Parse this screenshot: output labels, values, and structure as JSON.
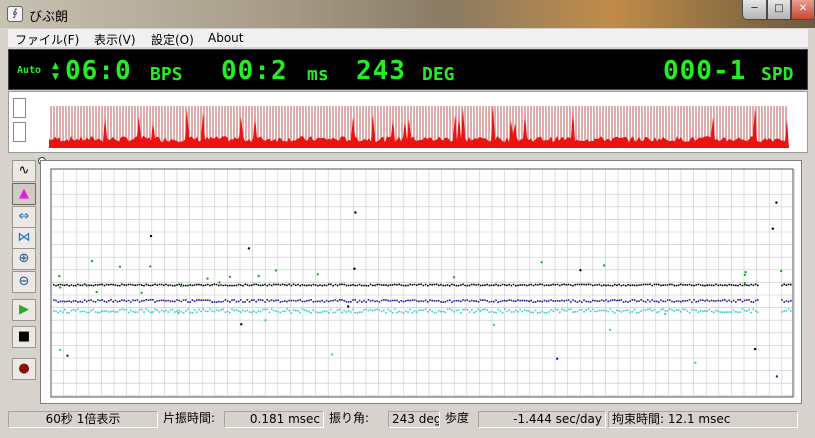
{
  "window": {
    "title": "びぶ朗",
    "app_icon_glyph": "∮",
    "minimize": "─",
    "maximize": "□",
    "close": "✕"
  },
  "menu": [
    {
      "label": "ファイル(F)"
    },
    {
      "label": "表示(V)"
    },
    {
      "label": "設定(O)"
    },
    {
      "label": "About"
    }
  ],
  "display": {
    "mode": "Auto",
    "bph_value": "06:0",
    "bph_unit": "BPS",
    "ms_value": "00:2",
    "ms_unit": "ms",
    "deg_value": "243",
    "deg_unit": "DEG",
    "spd_value": "000-1",
    "spd_unit": "SPD",
    "led_color": "#22ee22"
  },
  "colors": {
    "strip_wave": "#ee1111",
    "strip_bars": "#aa2222",
    "trace_black": "#000000",
    "trace_blue": "#1a1a9a",
    "trace_cyan": "#33cccc",
    "trace_green": "#22aa22",
    "grid": "#c8c8c8"
  },
  "tools": [
    {
      "icon": "sine-wave-icon",
      "glyph": "∿"
    },
    {
      "icon": "histogram-icon",
      "glyph": "▲"
    },
    {
      "icon": "expand-horizontal-icon",
      "glyph": "⇔"
    },
    {
      "icon": "compress-icon",
      "glyph": "⋈"
    },
    {
      "icon": "zoom-in-icon",
      "glyph": "⊕"
    },
    {
      "icon": "zoom-out-icon",
      "glyph": "⊖"
    },
    {
      "icon": "play-icon",
      "glyph": "▶"
    },
    {
      "icon": "stop-icon",
      "glyph": "■"
    },
    {
      "icon": "record-icon",
      "glyph": "●"
    }
  ],
  "status": {
    "view": "60秒 1倍表示",
    "lift_time_label": "片振時間:",
    "lift_time_value": "0.181 msec",
    "amplitude_label": "振り角:",
    "amplitude_value": "243 deg",
    "rate_label": "歩度",
    "rate_value": "-1.444 sec/day",
    "lock_time": "拘束時間: 12.1 msec"
  }
}
